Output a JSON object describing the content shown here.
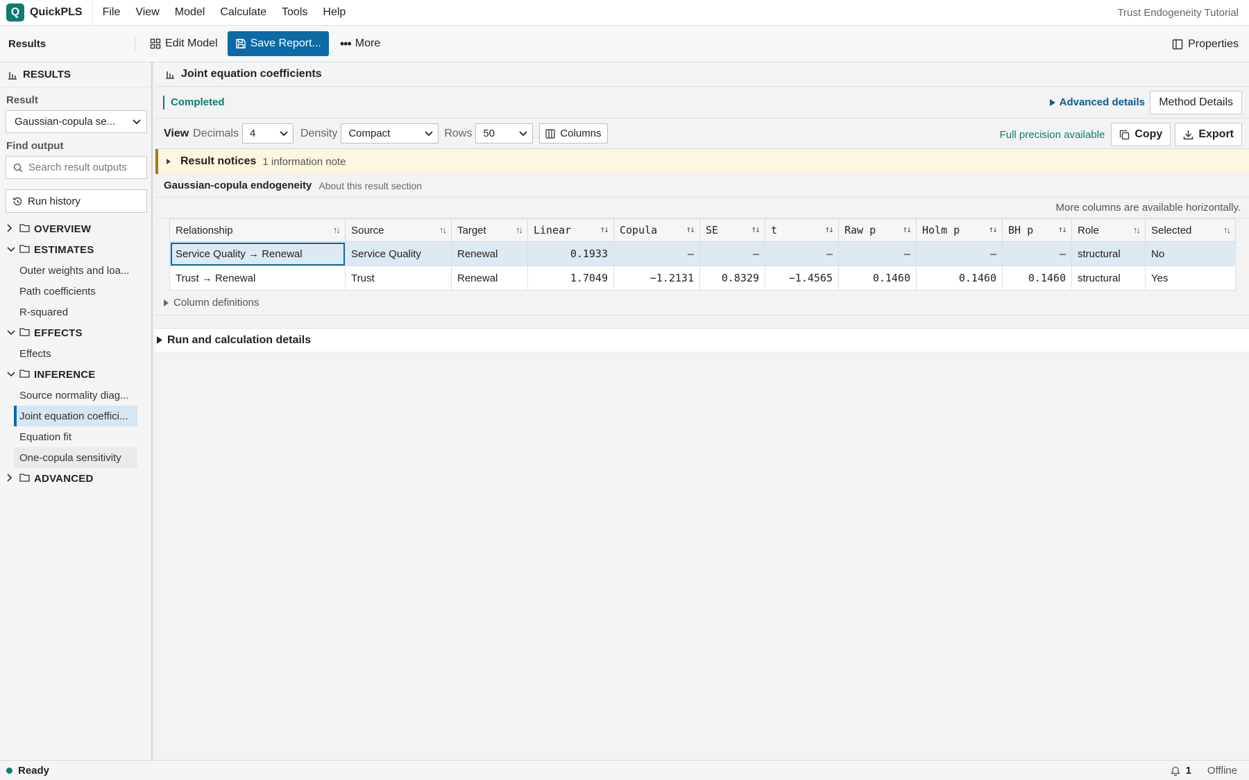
{
  "app": {
    "logo_letter": "Q",
    "name": "QuickPLS",
    "doc_title": "Trust Endogeneity Tutorial"
  },
  "menu": [
    "File",
    "View",
    "Model",
    "Calculate",
    "Tools",
    "Help"
  ],
  "toolbar": {
    "title": "Results",
    "edit_model": "Edit Model",
    "save_report": "Save Report...",
    "more": "More",
    "properties": "Properties"
  },
  "sidebar": {
    "header": "RESULTS",
    "result_label": "Result",
    "result_value": "Gaussian-copula se...",
    "find_label": "Find output",
    "search_placeholder": "Search result outputs",
    "run_history": "Run history",
    "groups": [
      {
        "label": "OVERVIEW",
        "expanded": false,
        "items": []
      },
      {
        "label": "ESTIMATES",
        "expanded": true,
        "items": [
          "Outer weights and loa...",
          "Path coefficients",
          "R-squared"
        ]
      },
      {
        "label": "EFFECTS",
        "expanded": true,
        "items": [
          "Effects"
        ]
      },
      {
        "label": "INFERENCE",
        "expanded": true,
        "items": [
          "Source normality diag...",
          "Joint equation coeffici...",
          "Equation fit",
          "One-copula sensitivity"
        ]
      },
      {
        "label": "ADVANCED",
        "expanded": false,
        "items": []
      }
    ],
    "active_item": "Joint equation coeffici..."
  },
  "main": {
    "title": "Joint equation coefficients",
    "status": "Completed",
    "advanced_details": "Advanced details",
    "method_details": "Method Details",
    "view": {
      "label": "View",
      "decimals_label": "Decimals",
      "decimals_value": "4",
      "density_label": "Density",
      "density_value": "Compact",
      "rows_label": "Rows",
      "rows_value": "50",
      "columns_btn": "Columns",
      "full_precision": "Full precision available",
      "copy": "Copy",
      "export": "Export"
    },
    "notice": {
      "title": "Result notices",
      "summary": "1 information note"
    },
    "section": {
      "title": "Gaussian-copula endogeneity",
      "about": "About this result section"
    },
    "more_columns": "More columns are available horizontally.",
    "table": {
      "columns": [
        "Relationship",
        "Source",
        "Target",
        "Linear",
        "Copula",
        "SE",
        "t",
        "Raw p",
        "Holm p",
        "BH p",
        "Role",
        "Selected"
      ],
      "rows": [
        [
          "Service Quality → Renewal",
          "Service Quality",
          "Renewal",
          "0.1933",
          "–",
          "–",
          "–",
          "–",
          "–",
          "–",
          "structural",
          "No"
        ],
        [
          "Trust → Renewal",
          "Trust",
          "Renewal",
          "1.7049",
          "−1.2131",
          "0.8329",
          "−1.4565",
          "0.1460",
          "0.1460",
          "0.1460",
          "structural",
          "Yes"
        ]
      ]
    },
    "column_definitions": "Column definitions",
    "run_details": "Run and calculation details"
  },
  "statusbar": {
    "status": "Ready",
    "notifications": "1",
    "connection": "Offline"
  }
}
